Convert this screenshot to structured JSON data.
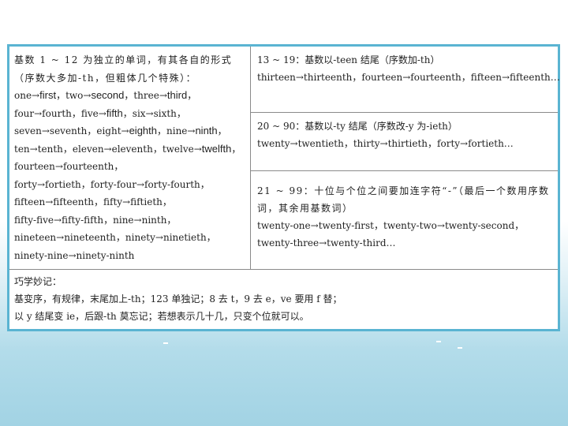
{
  "left": {
    "intro1": "基数 1 ~ 12 为独立的单词，有其各自的形式",
    "intro2": "（序数大多加-th，但粗体几个特殊）：",
    "row1": [
      {
        "t": "one→",
        "s": false
      },
      {
        "t": "first",
        "s": true
      },
      {
        "t": "，two→",
        "s": false
      },
      {
        "t": "second",
        "s": true
      },
      {
        "t": "，three→",
        "s": false
      },
      {
        "t": "third",
        "s": true
      },
      {
        "t": "，",
        "s": false
      }
    ],
    "row2": [
      {
        "t": "four→fourth，five→",
        "s": false
      },
      {
        "t": "fifth",
        "s": true
      },
      {
        "t": "，six→sixth，",
        "s": false
      }
    ],
    "row3": [
      {
        "t": "seven→seventh，eight→",
        "s": false
      },
      {
        "t": "eighth",
        "s": true
      },
      {
        "t": "，nine→",
        "s": false
      },
      {
        "t": "ninth",
        "s": true
      },
      {
        "t": "，",
        "s": false
      }
    ],
    "row4": [
      {
        "t": "ten→tenth，eleven→eleventh，twelve→",
        "s": false
      },
      {
        "t": "twelfth",
        "s": true
      },
      {
        "t": "，",
        "s": false
      }
    ],
    "plain": [
      "fourteen→fourteenth，",
      "forty→fortieth，forty-four→forty-fourth，",
      "fifteen→fifteenth，fifty→fiftieth，",
      "fifty-five→fifty-fifth，nine→ninth，",
      "nineteen→nineteenth，ninety→ninetieth，",
      "ninety-nine→ninety-ninth"
    ]
  },
  "right": {
    "c1_head": "13 ~ 19：基数以-teen 结尾（序数加-th）",
    "c1_body": "thirteen→thirteenth，fourteen→fourteenth，fifteen→fifteenth…",
    "c2_head": "20 ~ 90：基数以-ty 结尾（序数改-y 为-ieth）",
    "c2_body": "twenty→twentieth，thirty→thirtieth，forty→fortieth…",
    "c3_head1": "21 ~ 99：十位与个位之间要加连字符“-”（最后一个数用序数",
    "c3_head2": "词，其余用基数词）",
    "c3_body1": "twenty-one→twenty-first，twenty-two→twenty-second，",
    "c3_body2": "twenty-three→twenty-third…"
  },
  "tips": {
    "title": "巧学妙记：",
    "line1": "基变序，有规律，末尾加上-th；123 单独记；8 去 t，9 去 e，ve 要用 f 替；",
    "line2": "以 y 结尾变 ie，后跟-th 莫忘记；若想表示几十几，只变个位就可以。"
  }
}
